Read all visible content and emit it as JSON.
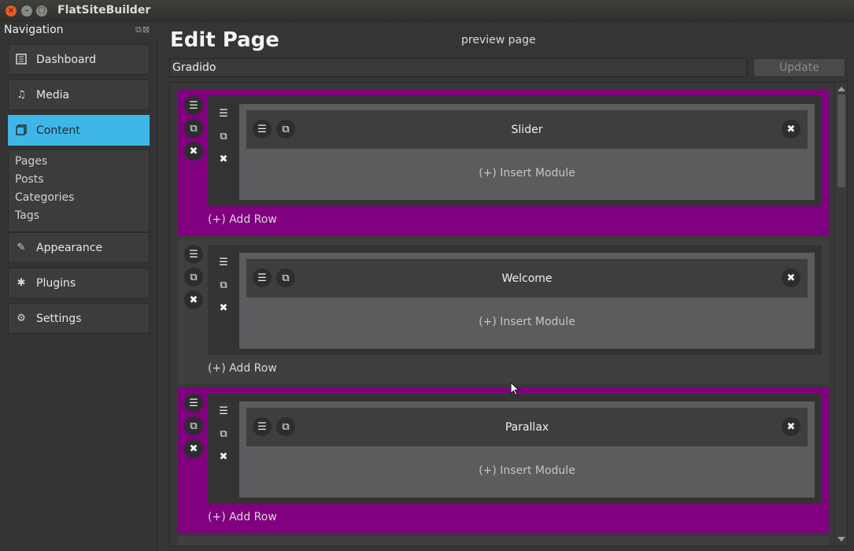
{
  "window": {
    "title": "FlatSiteBuilder"
  },
  "navigation": {
    "title": "Navigation",
    "items": [
      {
        "label": "Dashboard",
        "icon": "dashboard-icon",
        "active": false
      },
      {
        "label": "Media",
        "icon": "media-icon",
        "active": false
      },
      {
        "label": "Content",
        "icon": "content-icon",
        "active": true
      },
      {
        "label": "Appearance",
        "icon": "appearance-icon",
        "active": false
      },
      {
        "label": "Plugins",
        "icon": "plugins-icon",
        "active": false
      },
      {
        "label": "Settings",
        "icon": "settings-icon",
        "active": false
      }
    ],
    "content_subitems": [
      "Pages",
      "Posts",
      "Categories",
      "Tags"
    ]
  },
  "editor": {
    "title": "Edit Page",
    "preview_label": "preview page",
    "page_name": "Gradido",
    "update_label": "Update",
    "sections": [
      {
        "color": "#800080",
        "module": "Slider",
        "insert_label": "(+) Insert Module",
        "add_row_label": "(+) Add Row"
      },
      {
        "color": "#3f3f3f",
        "module": "Welcome",
        "insert_label": "(+) Insert Module",
        "add_row_label": "(+) Add Row"
      },
      {
        "color": "#800080",
        "module": "Parallax",
        "insert_label": "(+) Insert Module",
        "add_row_label": "(+) Add Row"
      }
    ]
  },
  "colors": {
    "accent": "#3fb6e8",
    "section_purple": "#800080",
    "background": "#353535"
  }
}
